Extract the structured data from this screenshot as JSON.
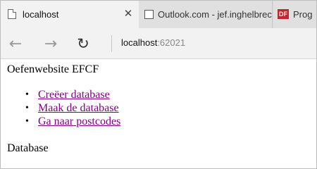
{
  "tabs": [
    {
      "title": "localhost",
      "icon": "page-icon",
      "active": true,
      "close_glyph": "✕"
    },
    {
      "title": "Outlook.com - jef.inghelbrec",
      "icon": "mail-icon",
      "active": false
    },
    {
      "title": "Prog",
      "icon": "brand-icon",
      "brand_text": "DF",
      "active": false
    }
  ],
  "navbar": {
    "back_glyph": "←",
    "forward_glyph": "→",
    "refresh_glyph": "↻",
    "address_host": "localhost",
    "address_port": ":62021"
  },
  "page": {
    "heading": "Oefenwebsite EFCF",
    "bullet": "•",
    "links": [
      {
        "label": "Creëer database"
      },
      {
        "label": "Maak de database"
      },
      {
        "label": "Ga naar postcodes"
      }
    ],
    "section_title": "Database"
  },
  "colors": {
    "visited_link": "#800080",
    "tab_active_bg": "#f2f2f2",
    "tabstrip_bg": "#dadada",
    "brand_red": "#c0272d"
  }
}
